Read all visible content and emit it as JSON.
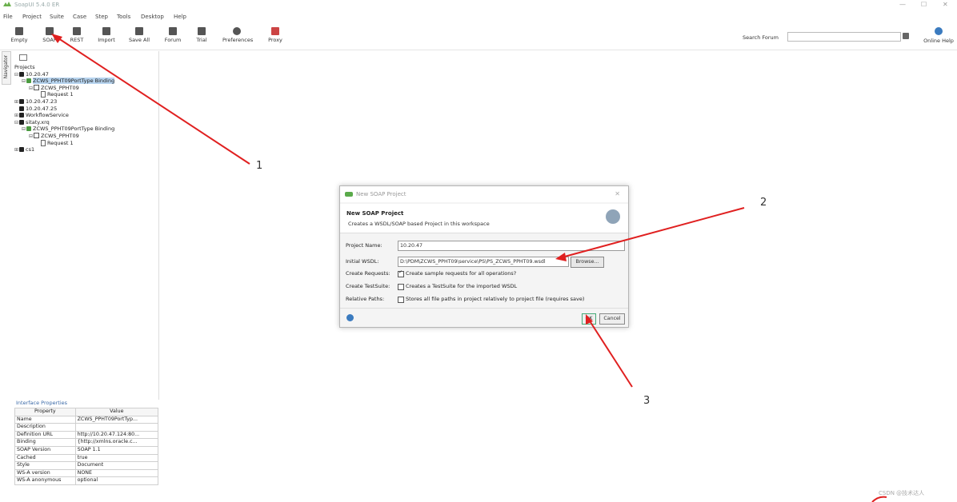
{
  "app": {
    "title": "SoapUI 5.4.0 ER",
    "window_controls": [
      "—",
      "☐",
      "✕"
    ]
  },
  "menu": [
    "File",
    "Project",
    "Suite",
    "Case",
    "Step",
    "Tools",
    "Desktop",
    "Help"
  ],
  "toolbar": {
    "buttons": [
      "Empty",
      "SOAP",
      "REST",
      "Import",
      "Save All",
      "Forum",
      "Trial",
      "Preferences",
      "Proxy"
    ],
    "search_label": "Search Forum",
    "search_value": "",
    "help_label": "Online Help"
  },
  "navigator": {
    "tab_label": "Navigator",
    "projects_label": "Projects",
    "tree": [
      {
        "exp": "⊟",
        "icon": "folder",
        "label": "10.20.47",
        "level": 0
      },
      {
        "exp": "⊟",
        "icon": "iface",
        "label": "ZCWS_PPHT09PortType Binding",
        "level": 1,
        "selected": true
      },
      {
        "exp": "⊟",
        "icon": "op",
        "label": "ZCWS_PPHT09",
        "level": 2
      },
      {
        "exp": "",
        "icon": "req",
        "label": "Request 1",
        "level": 3
      },
      {
        "exp": "⊞",
        "icon": "folder",
        "label": "10.20.47.23",
        "level": 0
      },
      {
        "exp": "",
        "icon": "folder",
        "label": "10.20.47.25",
        "level": 0
      },
      {
        "exp": "⊞",
        "icon": "folder",
        "label": "WorkflowService",
        "level": 0
      },
      {
        "exp": "⊟",
        "icon": "folder",
        "label": "sitaty.xrq",
        "level": 0
      },
      {
        "exp": "⊟",
        "icon": "iface",
        "label": "ZCWS_PPHT09PortType Binding",
        "level": 1
      },
      {
        "exp": "⊟",
        "icon": "op",
        "label": "ZCWS_PPHT09",
        "level": 2
      },
      {
        "exp": "",
        "icon": "req",
        "label": "Request 1",
        "level": 3
      },
      {
        "exp": "⊞",
        "icon": "folder",
        "label": "cs1",
        "level": 0
      }
    ]
  },
  "properties": {
    "title": "Interface Properties",
    "headers": [
      "Property",
      "Value"
    ],
    "rows": [
      [
        "Name",
        "ZCWS_PPHT09PortTyp..."
      ],
      [
        "Description",
        ""
      ],
      [
        "Definition URL",
        "http://10.20.47.124:80..."
      ],
      [
        "Binding",
        "{http://xmlns.oracle.c..."
      ],
      [
        "SOAP Version",
        "SOAP 1.1"
      ],
      [
        "Cached",
        "true"
      ],
      [
        "Style",
        "Document"
      ],
      [
        "WS-A version",
        "NONE"
      ],
      [
        "WS-A anonymous",
        "optional"
      ]
    ]
  },
  "dialog": {
    "window_title": "New SOAP Project",
    "heading": "New SOAP Project",
    "subheading": "Creates a WSDL/SOAP based Project in this workspace",
    "project_name_label": "Project Name:",
    "project_name_value": "10.20.47",
    "wsdl_label": "Initial WSDL:",
    "wsdl_value": "D:\\PDM\\ZCWS_PPHT09\\service\\PS\\PS_ZCWS_PPHT09.wsdl",
    "browse_label": "Browse...",
    "create_requests_label": "Create Requests:",
    "create_requests_text": "Create sample requests for all operations?",
    "create_requests_checked": true,
    "create_testsuite_label": "Create TestSuite:",
    "create_testsuite_text": "Creates a TestSuite for the imported WSDL",
    "create_testsuite_checked": false,
    "relative_paths_label": "Relative Paths:",
    "relative_paths_text": "Stores all file paths in project relatively to project file (requires save)",
    "relative_paths_checked": false,
    "ok_label": "OK",
    "cancel_label": "Cancel"
  },
  "annotations": {
    "labels": [
      "1",
      "2",
      "3"
    ],
    "arrow_color": "#e02020"
  },
  "watermark": "CSDN @技术达人"
}
